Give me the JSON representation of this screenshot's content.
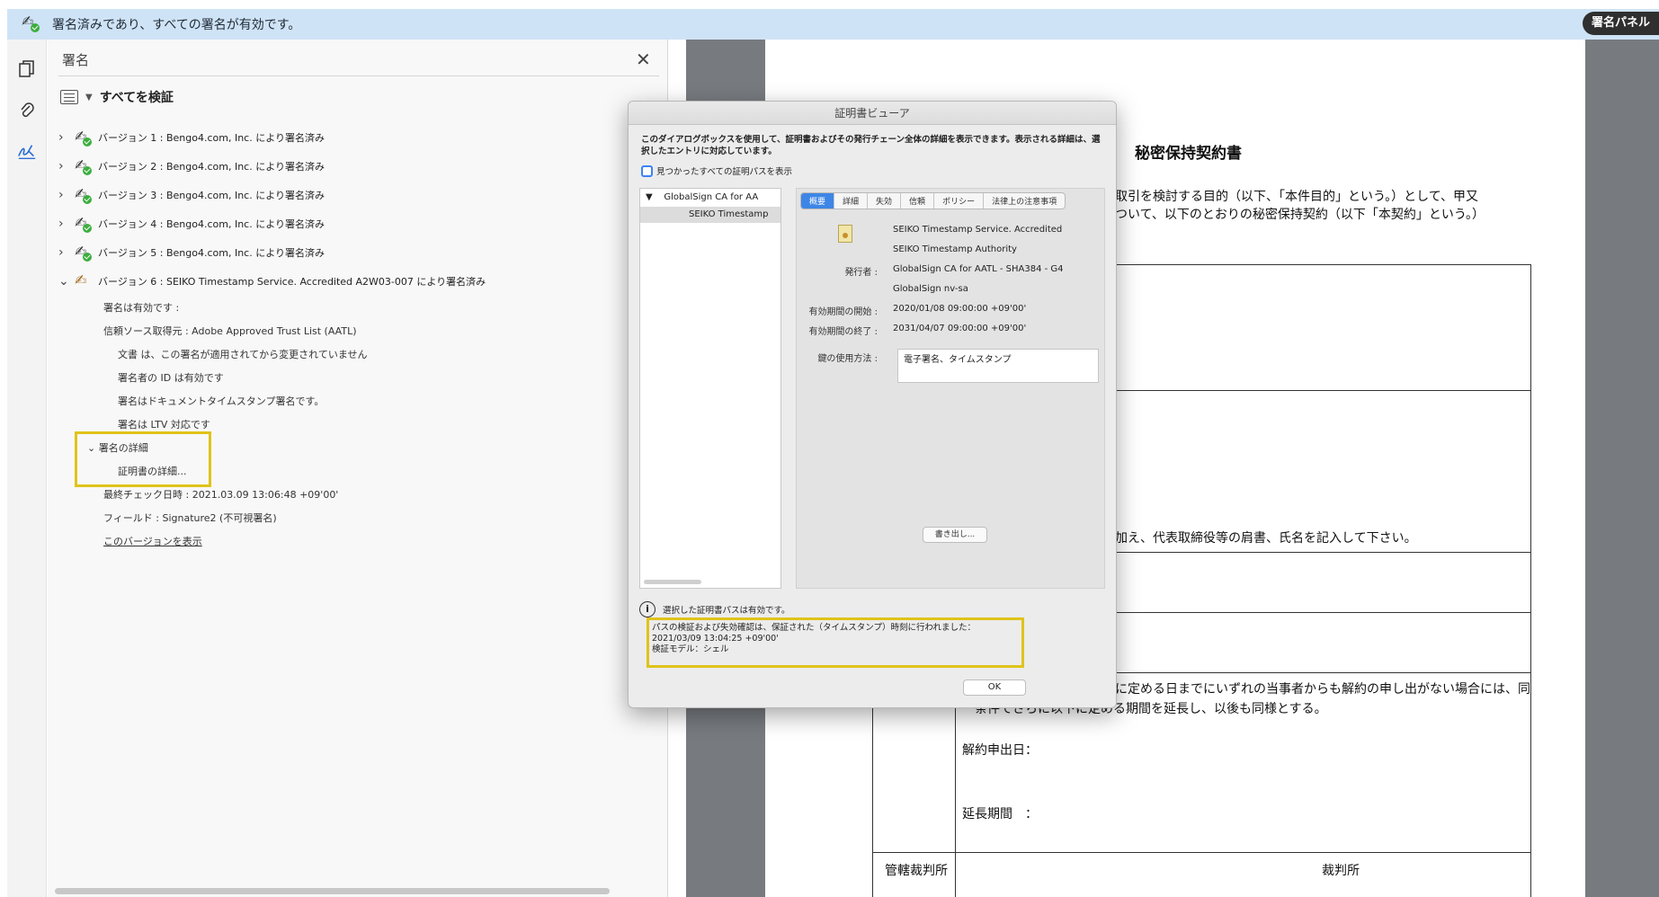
{
  "banner": {
    "icon": "signature-valid-icon",
    "text": "署名済みであり、すべての署名が有効です。",
    "panel_button": "署名パネル"
  },
  "toolstrip": {
    "icons": [
      "pages-icon",
      "attachment-icon",
      "signature-icon"
    ]
  },
  "signature_panel": {
    "title": "署名",
    "verify_all": "すべてを検証",
    "versions": [
      {
        "label": "バージョン 1 : Bengo4.com, Inc. により署名済み"
      },
      {
        "label": "バージョン 2 : Bengo4.com, Inc. により署名済み"
      },
      {
        "label": "バージョン 3 : Bengo4.com, Inc. により署名済み"
      },
      {
        "label": "バージョン 4 : Bengo4.com, Inc. により署名済み"
      },
      {
        "label": "バージョン 5 : Bengo4.com, Inc. により署名済み"
      },
      {
        "label": "バージョン 6 : SEIKO Timestamp Service. Accredited A2W03-007 により署名済み"
      }
    ],
    "details": {
      "valid": "署名は有効です :",
      "trust_source": "信頼ソース取得元 : Adobe Approved Trust List (AATL)",
      "unchanged": "文書 は、この署名が適用されてから変更されていません",
      "signer_id": "署名者の ID は有効です",
      "timestamp": "署名はドキュメントタイムスタンプ署名です。",
      "ltv": "署名は LTV 対応です",
      "sig_details": "署名の詳細",
      "cert_details": "証明書の詳細...",
      "last_checked": "最終チェック日時 : 2021.03.09 13:06:48 +09'00'",
      "field": "フィールド : Signature2 (不可視署名)",
      "show_version": "このバージョンを表示"
    }
  },
  "document": {
    "title": "秘密保持契約書",
    "line1": "取引を検討する目的（以下、「本件目的」という。）として、甲又",
    "line2": "ついて、以下のとおりの秘密保持契約（以下「本契約」という。）",
    "line3": "加え、代表取締役等の肩書、氏名を記入して下さい。",
    "line4": "に定める日までにいずれの当事者からも解約の申し出がない場合には、同",
    "line5": "条件でさらに以下に定める期間を延長し、以後も同様とする。",
    "cancel_date": "解約申出日：",
    "extension": "延長期間　：",
    "court_label": "管轄裁判所",
    "court_value": "裁判所"
  },
  "dialog": {
    "title": "証明書ビューア",
    "description": "このダイアログボックスを使用して、証明書およびその発行チェーン全体の詳細を表示できます。表示される詳細は、選択したエントリに対応しています。",
    "show_all_paths": "見つかったすべての証明パスを表示",
    "tree": {
      "root": "GlobalSign CA for AA",
      "child": "SEIKO Timestamp"
    },
    "tabs": [
      "概要",
      "詳細",
      "失効",
      "信頼",
      "ポリシー",
      "法律上の注意事項"
    ],
    "subject_line1": "SEIKO Timestamp Service. Accredited",
    "subject_line2": "SEIKO Timestamp Authority",
    "issuer_label": "発行者 :",
    "issuer_line1": "GlobalSign CA for AATL - SHA384 - G4",
    "issuer_line2": "GlobalSign nv-sa",
    "valid_from_label": "有効期間の開始 :",
    "valid_from": "2020/01/08 09:00:00 +09'00'",
    "valid_to_label": "有効期間の終了 :",
    "valid_to": "2031/04/07 09:00:00 +09'00'",
    "key_usage_label": "鍵の使用方法 :",
    "key_usage": "電子署名、タイムスタンプ",
    "export_button": "書き出し...",
    "path_valid": "選択した証明書パスは有効です。",
    "path_check_line1": "パスの検証および失効確認は、保証された（タイムスタンプ）時刻に行われました：",
    "path_check_line2": "2021/03/09 13:04:25 +09'00'",
    "path_check_line3": "検証モデル：シェル",
    "ok_button": "OK"
  },
  "colors": {
    "banner_bg": "#cfe3f6",
    "highlight": "#e0c31a",
    "active_tab": "#3d86e6",
    "valid_check": "#3dae3f"
  }
}
